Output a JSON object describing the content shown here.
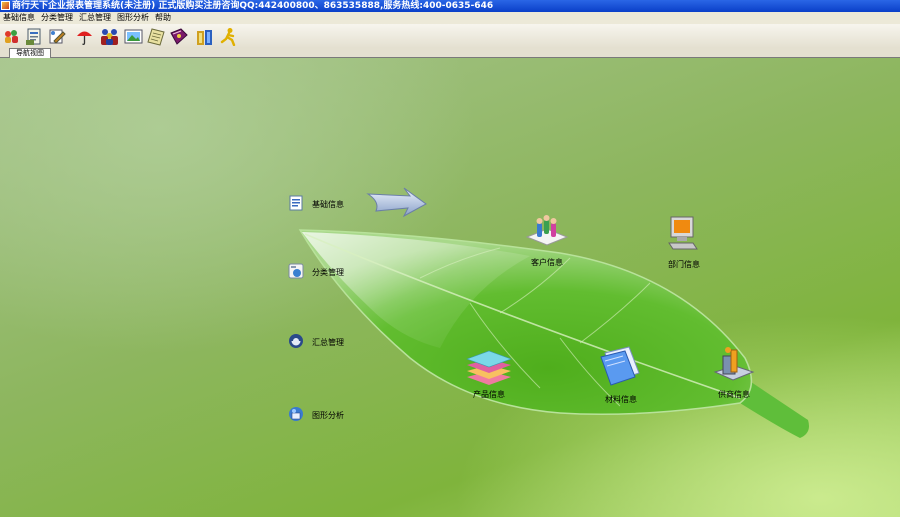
{
  "window": {
    "title": "商行天下企业报表管理系统(未注册) 正式版购买注册咨询QQ:442400800、863535888,服务热线:400-0635-646"
  },
  "menu": [
    "基础信息",
    "分类管理",
    "汇总管理",
    "图形分析",
    "帮助"
  ],
  "toolbar": {
    "icons": [
      "people-icon",
      "report-icon",
      "tools-icon",
      "umbrella-icon",
      "users-icon",
      "image-icon",
      "notepad-icon",
      "book-icon",
      "gift-icon",
      "runner-icon"
    ]
  },
  "tabs": [
    "导航视图"
  ],
  "nav": {
    "items": [
      {
        "label": "基础信息",
        "icon": "document-icon"
      },
      {
        "label": "分类管理",
        "icon": "category-icon"
      },
      {
        "label": "汇总管理",
        "icon": "summary-icon"
      },
      {
        "label": "图形分析",
        "icon": "chart-analysis-icon"
      }
    ]
  },
  "nodes": [
    {
      "label": "客户信息",
      "icon": "customers-icon"
    },
    {
      "label": "部门信息",
      "icon": "computer-icon"
    },
    {
      "label": "产品信息",
      "icon": "product-stack-icon"
    },
    {
      "label": "材料信息",
      "icon": "material-files-icon"
    },
    {
      "label": "供商信息",
      "icon": "supplier-icon"
    }
  ],
  "colors": {
    "titlebar": "#0a3fc8",
    "leaf": "#5cb82a",
    "background": "#8db65e"
  }
}
